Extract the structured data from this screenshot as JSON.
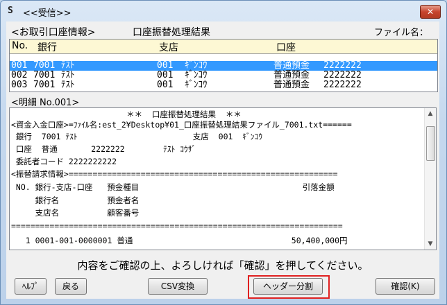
{
  "window": {
    "title": "<<受信>>",
    "close_label": "✕",
    "icon_glyph": "S"
  },
  "header": {
    "account_info_label": "<お取引口座情報>",
    "result_title": "口座振替処理結果",
    "file_name_label": "ファイル名："
  },
  "grid": {
    "columns": [
      "No.",
      "銀行",
      "支店",
      "口座"
    ],
    "rows": [
      {
        "no": "001",
        "bank_code": "7001",
        "bank_name": "ﾃｽﾄ",
        "branch_code": "001",
        "branch_name": "ｷﾞﾝｺｳ",
        "account_type": "普通預金",
        "account_no": "2222222",
        "selected": true
      },
      {
        "no": "002",
        "bank_code": "7001",
        "bank_name": "ﾃｽﾄ",
        "branch_code": "001",
        "branch_name": "ｷﾞﾝｺｳ",
        "account_type": "普通預金",
        "account_no": "2222222",
        "selected": false
      },
      {
        "no": "003",
        "bank_code": "7001",
        "bank_name": "ﾃｽﾄ",
        "branch_code": "001",
        "branch_name": "ｷﾞﾝｺｳ",
        "account_type": "普通預金",
        "account_no": "2222222",
        "selected": false
      }
    ]
  },
  "detail": {
    "label": "<明細 No.001>",
    "lines": [
      "                        ＊＊  口座振替処理結果  ＊＊",
      "<資金入金口座>=ﾌｧｲﾙ名:est_2¥Desktop¥01_口座振替処理結果ファイル_7001.txt======",
      " 銀行  7001 ﾃｽﾄ                        支店  001  ｷﾞﾝｺｳ",
      " 口座  普通       2222222        ﾃｽﾄ ｺｳｻﾞ",
      " 委託者コード 2222222222",
      "<振替請求情報>========================================================",
      " NO. 銀行-支店-口座   預金種目                                  引落金額",
      "     銀行名          預金者名",
      "     支店名          顧客番号",
      "=====================================================================",
      "   1 0001-001-0000001 普通                                 50,400,000円"
    ]
  },
  "confirm_message": "内容をご確認の上、よろしければ「確認」を押してください。",
  "buttons": {
    "help": "ﾍﾙﾌﾟ",
    "back": "戻る",
    "csv": "CSV変換",
    "header_split": "ヘッダー分割",
    "confirm": "確認(K)"
  },
  "colors": {
    "selection": "#3399ff",
    "highlight_border": "#e02020",
    "grid_header": "#fdf8d4"
  }
}
